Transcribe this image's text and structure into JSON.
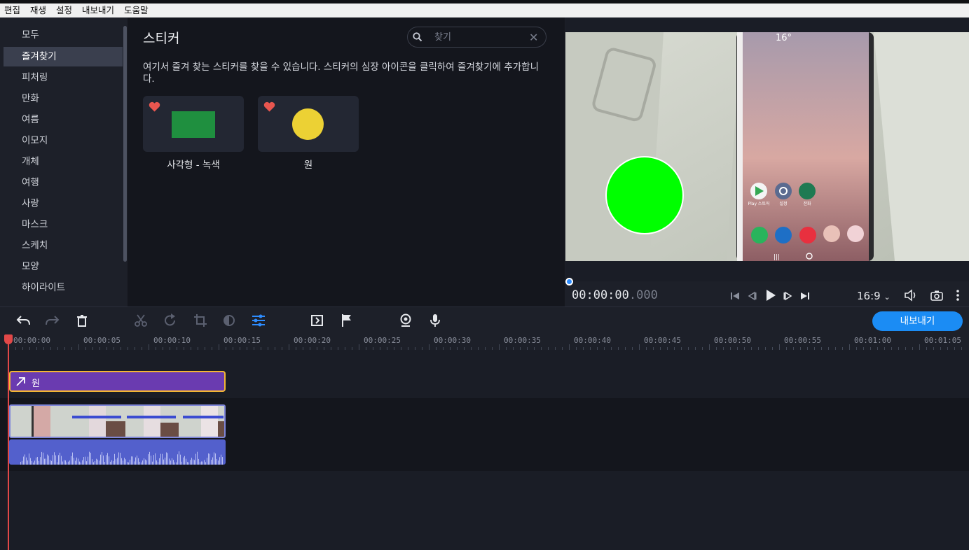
{
  "menu": [
    "편집",
    "재생",
    "설정",
    "내보내기",
    "도움말"
  ],
  "sidebar": {
    "items": [
      "모두",
      "즐겨찾기",
      "피처링",
      "만화",
      "여름",
      "이모지",
      "개체",
      "여행",
      "사랑",
      "마스크",
      "스케치",
      "모양",
      "하이라이트"
    ],
    "active_index": 1
  },
  "panel": {
    "title": "스티커",
    "search_placeholder": "찾기",
    "description": "여기서 즐겨 찾는 스티커를 찾을 수 있습니다. 스티커의 심장 아이콘을 클릭하여 즐겨찾기에 추가합니다.",
    "stickers": [
      {
        "label": "사각형 - 녹색",
        "shape": "rectangle",
        "color": "#1f8f3f",
        "favorite": true
      },
      {
        "label": "원",
        "shape": "circle",
        "color": "#ecd134",
        "favorite": true
      }
    ]
  },
  "preview": {
    "overlay_color": "#00ff00",
    "phone": {
      "temperature": "16°",
      "apps_row1": [
        "Play 스토어",
        "설정",
        "전화"
      ]
    },
    "timecode_main": "00:00:00",
    "timecode_ms": ".000",
    "aspect_ratio": "16:9",
    "controls": [
      "skip-back-icon",
      "step-back-icon",
      "play-icon",
      "step-forward-icon",
      "skip-forward-icon"
    ]
  },
  "toolbar": {
    "export_label": "내보내기",
    "tools": [
      "undo-icon",
      "redo-icon",
      "trash-icon",
      "cut-icon",
      "rotate-icon",
      "crop-icon",
      "color-icon",
      "adjust-icon",
      "transition-icon",
      "marker-icon",
      "webcam-icon",
      "microphone-icon"
    ]
  },
  "timeline": {
    "ticks": [
      "00:00:00",
      "00:00:05",
      "00:00:10",
      "00:00:15",
      "00:00:20",
      "00:00:25",
      "00:00:30",
      "00:00:35",
      "00:00:40",
      "00:00:45",
      "00:00:50",
      "00:00:55",
      "00:01:00",
      "00:01:05"
    ],
    "sticker_clip_label": "원",
    "colors": {
      "sticker_clip": "#6a3bb0",
      "clip_border": "#f3b633",
      "audio": "#5360cc",
      "playhead": "#e24848",
      "accent": "#1b8cf4"
    }
  }
}
